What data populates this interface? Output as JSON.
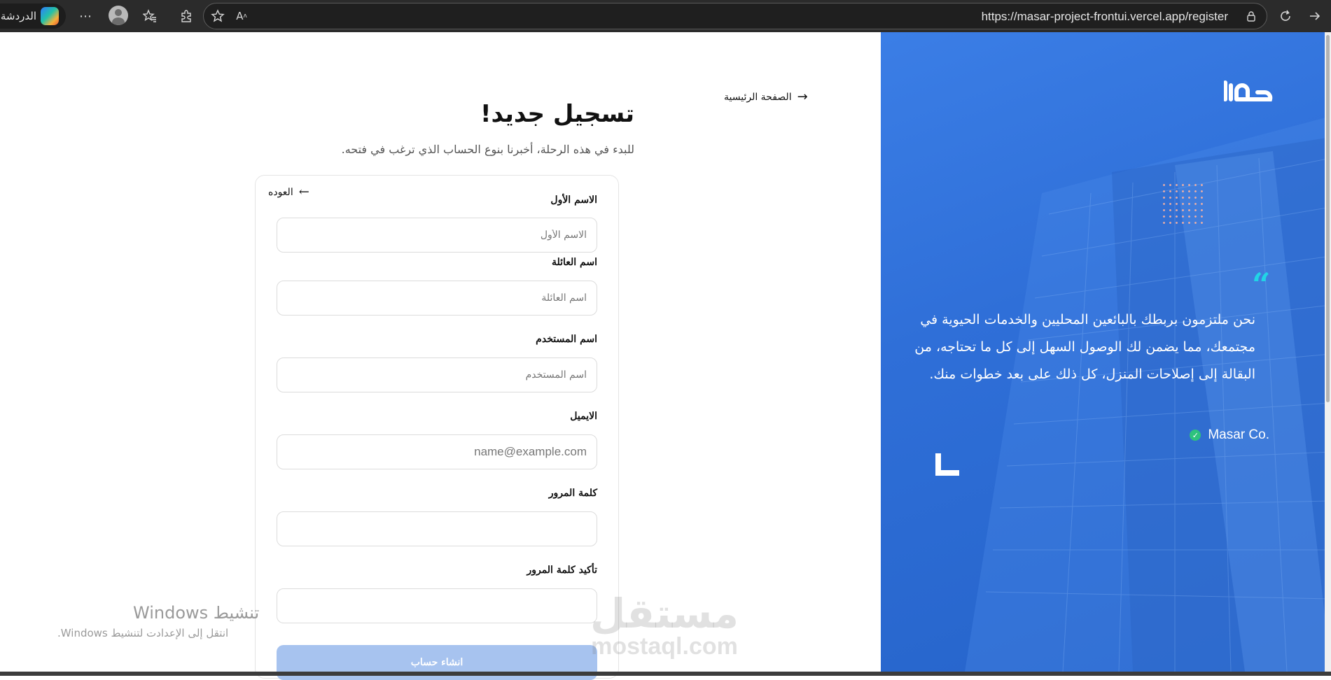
{
  "browser": {
    "chat_label": "الدردشة",
    "more_icon": "⋯",
    "url": "https://masar-project-frontui.vercel.app/register"
  },
  "nav": {
    "home_label": "الصفحة الرئيسية",
    "back_label": "العوده"
  },
  "page": {
    "title": "تسجيل جديد!",
    "subtitle": "للبدء في هذه الرحلة، أخبرنا بنوع الحساب الذي ترغب في فتحه."
  },
  "form": {
    "first_name": {
      "label": "الاسم الأول",
      "placeholder": "الاسم الأول",
      "value": ""
    },
    "last_name": {
      "label": "اسم العائلة",
      "placeholder": "اسم العائلة",
      "value": ""
    },
    "username": {
      "label": "اسم المستخدم",
      "placeholder": "اسم المستخدم",
      "value": ""
    },
    "email": {
      "label": "الايميل",
      "placeholder": "name@example.com",
      "value": ""
    },
    "password": {
      "label": "كلمة المرور",
      "placeholder": "",
      "value": ""
    },
    "confirm_password": {
      "label": "تأكيد كلمة المرور",
      "placeholder": "",
      "value": ""
    },
    "submit_label": "انشاء حساب"
  },
  "hero": {
    "quote": "نحن ملتزمون بربطك بالبائعين المحليين والخدمات الحيوية في مجتمعك، مما يضمن لك الوصول السهل إلى كل ما تحتاجه، من البقالة إلى إصلاحات المنزل، كل ذلك على بعد خطوات منك.",
    "company": "Masar Co."
  },
  "watermarks": {
    "windows_title": "تنشيط Windows",
    "windows_sub": "انتقل إلى الإعدادت لتنشيط Windows.",
    "mostaql_ar": "مستقل",
    "mostaql_en": "mostaql.com"
  },
  "colors": {
    "brand_blue": "#2f6fd8",
    "accent_cyan": "#21d4e6",
    "submit_disabled": "#a7c3ef",
    "verified_green": "#2ec27e"
  }
}
